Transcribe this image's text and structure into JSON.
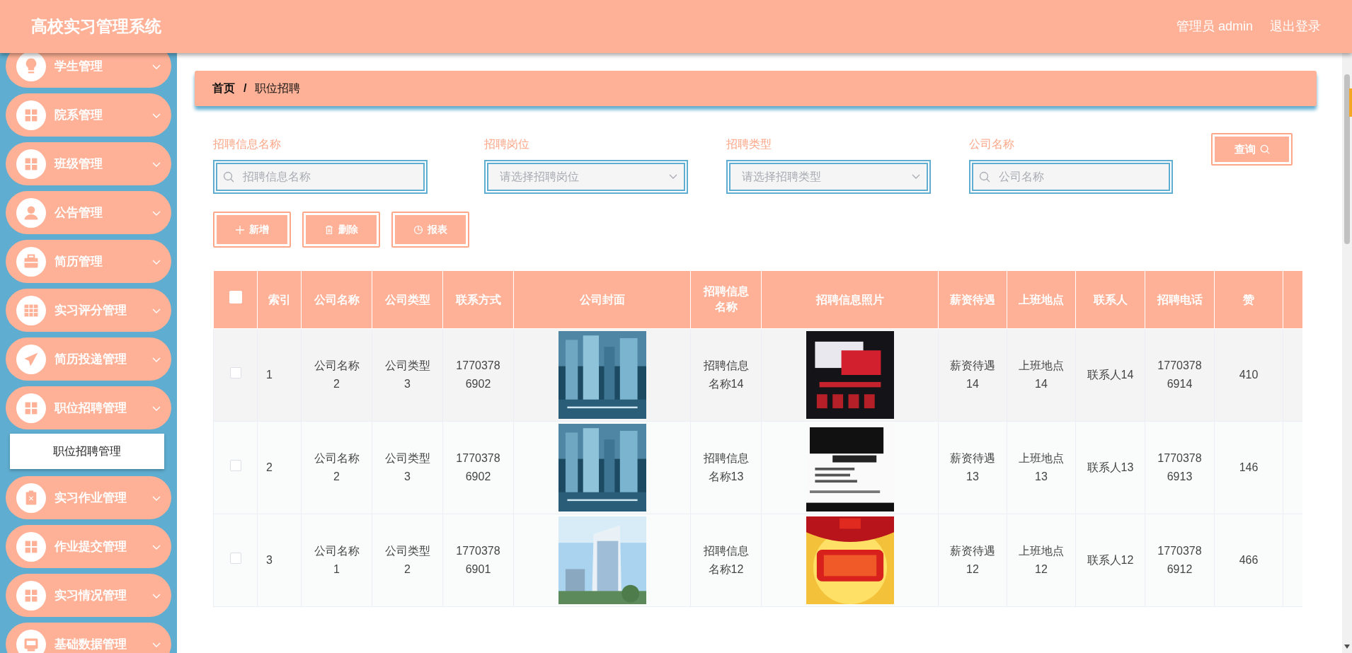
{
  "header": {
    "title": "高校实习管理系统",
    "user": "管理员 admin",
    "logout": "退出登录"
  },
  "sidebar": {
    "items": [
      {
        "label": "学生管理"
      },
      {
        "label": "院系管理"
      },
      {
        "label": "班级管理"
      },
      {
        "label": "公告管理"
      },
      {
        "label": "简历管理"
      },
      {
        "label": "实习评分管理"
      },
      {
        "label": "简历投递管理"
      },
      {
        "label": "职位招聘管理",
        "children": [
          {
            "label": "职位招聘管理",
            "selected": true
          }
        ]
      },
      {
        "label": "实习作业管理"
      },
      {
        "label": "作业提交管理"
      },
      {
        "label": "实习情况管理"
      },
      {
        "label": "基础数据管理"
      }
    ]
  },
  "breadcrumb": {
    "separator": "/",
    "items": [
      "首页",
      "职位招聘"
    ]
  },
  "filters": [
    {
      "kind": "search",
      "label": "招聘信息名称",
      "placeholder": "招聘信息名称"
    },
    {
      "kind": "select",
      "label": "招聘岗位",
      "placeholder": "请选择招聘岗位"
    },
    {
      "kind": "select",
      "label": "招聘类型",
      "placeholder": "请选择招聘类型"
    },
    {
      "kind": "search",
      "label": "公司名称",
      "placeholder": "公司名称"
    }
  ],
  "query_button": "查询",
  "actions": [
    {
      "kind": "add",
      "label": "新增"
    },
    {
      "kind": "delete",
      "label": "删除"
    },
    {
      "kind": "report",
      "label": "报表"
    }
  ],
  "table": {
    "select_all": {
      "checked": false
    },
    "columns": [
      {
        "label": "索引",
        "kind": "text"
      },
      {
        "label": "公司名称",
        "kind": "text"
      },
      {
        "label": "公司类型",
        "kind": "text"
      },
      {
        "label": "联系方式",
        "kind": "text"
      },
      {
        "label": "公司封面",
        "kind": "picture"
      },
      {
        "label": "招聘信息名称",
        "kind": "text"
      },
      {
        "label": "招聘信息照片",
        "kind": "picture"
      },
      {
        "label": "薪资待遇",
        "kind": "text"
      },
      {
        "label": "上班地点",
        "kind": "text"
      },
      {
        "label": "联系人",
        "kind": "text"
      },
      {
        "label": "招聘电话",
        "kind": "text"
      },
      {
        "label": "赞",
        "kind": "text"
      }
    ],
    "rows": [
      {
        "checked": false,
        "cells": [
          "1",
          "公司名称2",
          "公司类型3",
          "17703786902",
          {
            "kind": "picture"
          },
          "招聘信息名称14",
          {
            "kind": "picture"
          },
          "薪资待遇14",
          "上班地点14",
          "联系人14",
          "17703786914",
          "410"
        ]
      },
      {
        "checked": false,
        "cells": [
          "2",
          "公司名称2",
          "公司类型3",
          "17703786902",
          {
            "kind": "picture"
          },
          "招聘信息名称13",
          {
            "kind": "picture"
          },
          "薪资待遇13",
          "上班地点13",
          "联系人13",
          "17703786913",
          "146"
        ]
      },
      {
        "checked": false,
        "cells": [
          "3",
          "公司名称1",
          "公司类型2",
          "17703786901",
          {
            "kind": "picture"
          },
          "招聘信息名称12",
          {
            "kind": "picture"
          },
          "薪资待遇12",
          "上班地点12",
          "联系人12",
          "17703786912",
          "466"
        ]
      }
    ]
  }
}
